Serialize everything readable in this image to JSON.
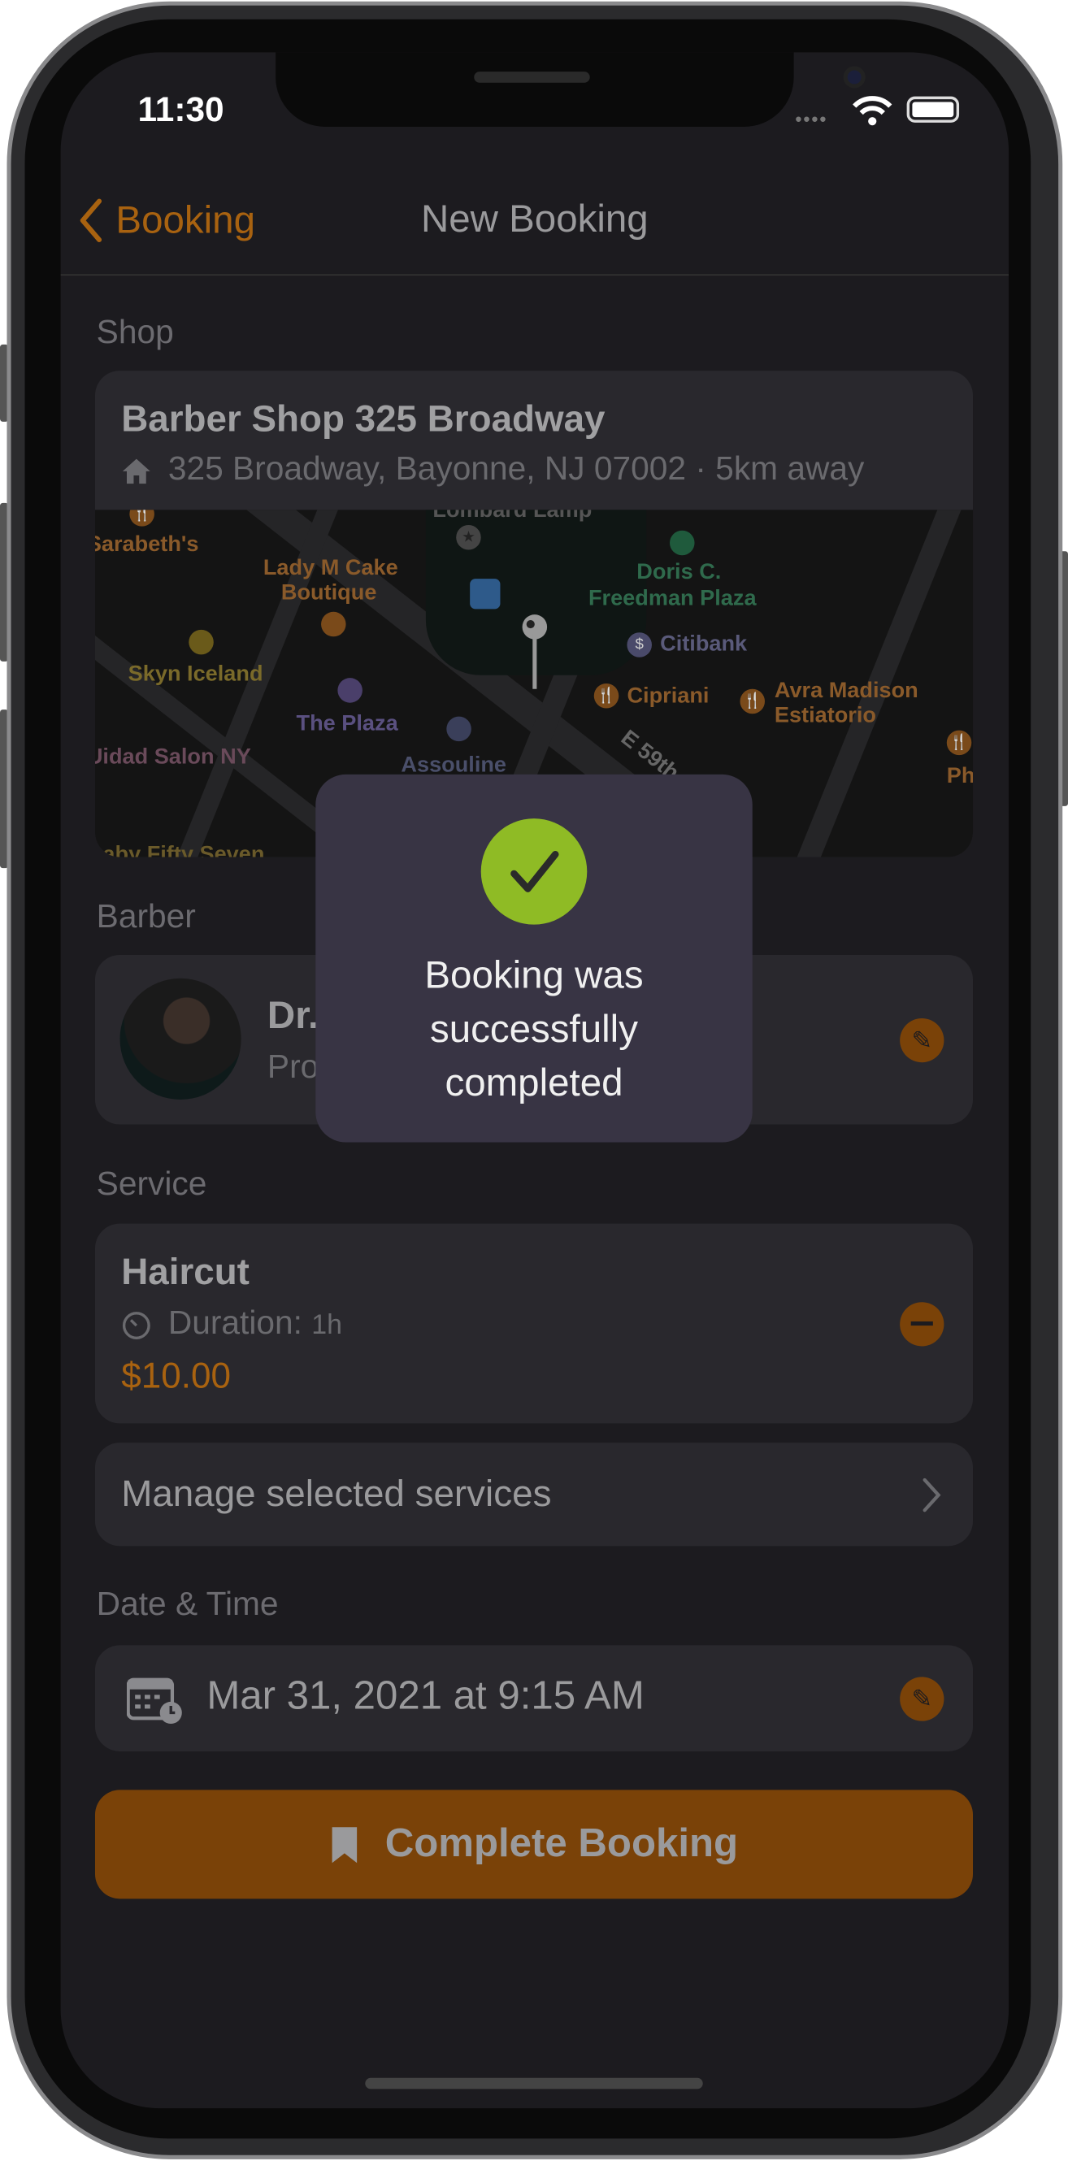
{
  "status_bar": {
    "time": "11:30"
  },
  "nav": {
    "back_label": "Booking",
    "title": "New Booking"
  },
  "shop": {
    "section_label": "Shop",
    "name": "Barber Shop 325 Broadway",
    "address": "325 Broadway, Bayonne, NJ 07002 · 5km away",
    "map_labels": [
      "Lombard Lamp",
      "Sarabeth's",
      "Lady M Cake",
      "Boutique",
      "Doris C.",
      "Freedman Plaza",
      "Citibank",
      "Skyn Iceland",
      "Cipriani",
      "Avra Madison",
      "Estiatorio",
      "The Plaza",
      "Uidad Salon NY",
      "Assouline",
      "E 59th",
      "Philip",
      "Baby Fifty Seven"
    ]
  },
  "barber": {
    "section_label": "Barber",
    "name_partial": "Dr.",
    "subtitle_partial": "Pro"
  },
  "service": {
    "section_label": "Service",
    "name": "Haircut",
    "duration_label": "Duration:",
    "duration_value": "1h",
    "price": "$10.00",
    "manage_label": "Manage selected services"
  },
  "datetime": {
    "section_label": "Date & Time",
    "value": "Mar 31, 2021 at 9:15 AM"
  },
  "complete_button": {
    "label": "Complete Booking"
  },
  "toast": {
    "line1": "Booking was",
    "line2": "successfully",
    "line3": "completed"
  },
  "colors": {
    "accent": "#7a4208",
    "accent_text": "#a86210",
    "success": "#8fbb25",
    "toast_bg": "#383444",
    "background": "#1c1b1f",
    "card": "#29282d"
  }
}
